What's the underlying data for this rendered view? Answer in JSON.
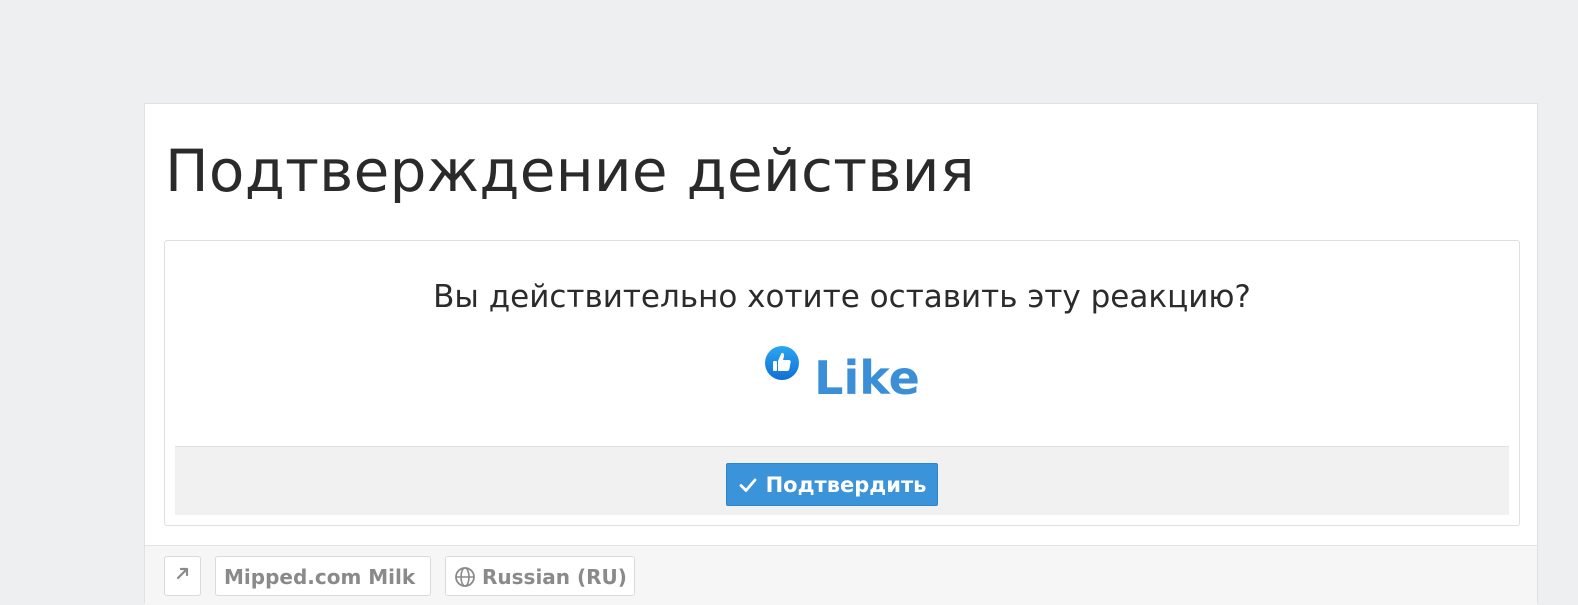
{
  "page": {
    "title": "Подтверждение действия"
  },
  "confirm": {
    "question": "Вы действительно хотите оставить эту реакцию?",
    "reaction": {
      "label": "Like",
      "icon": "thumbs-up-icon",
      "color": "#3a8fd6"
    },
    "button_label": "Подтвердить",
    "button_icon": "check-icon",
    "button_color": "#3b93d9"
  },
  "footer": {
    "style_chooser": "Mipped.com Milk",
    "language_chooser": "Russian (RU)",
    "language_icon": "globe-icon",
    "back_to_top_icon": "arrow-up-right-icon"
  }
}
